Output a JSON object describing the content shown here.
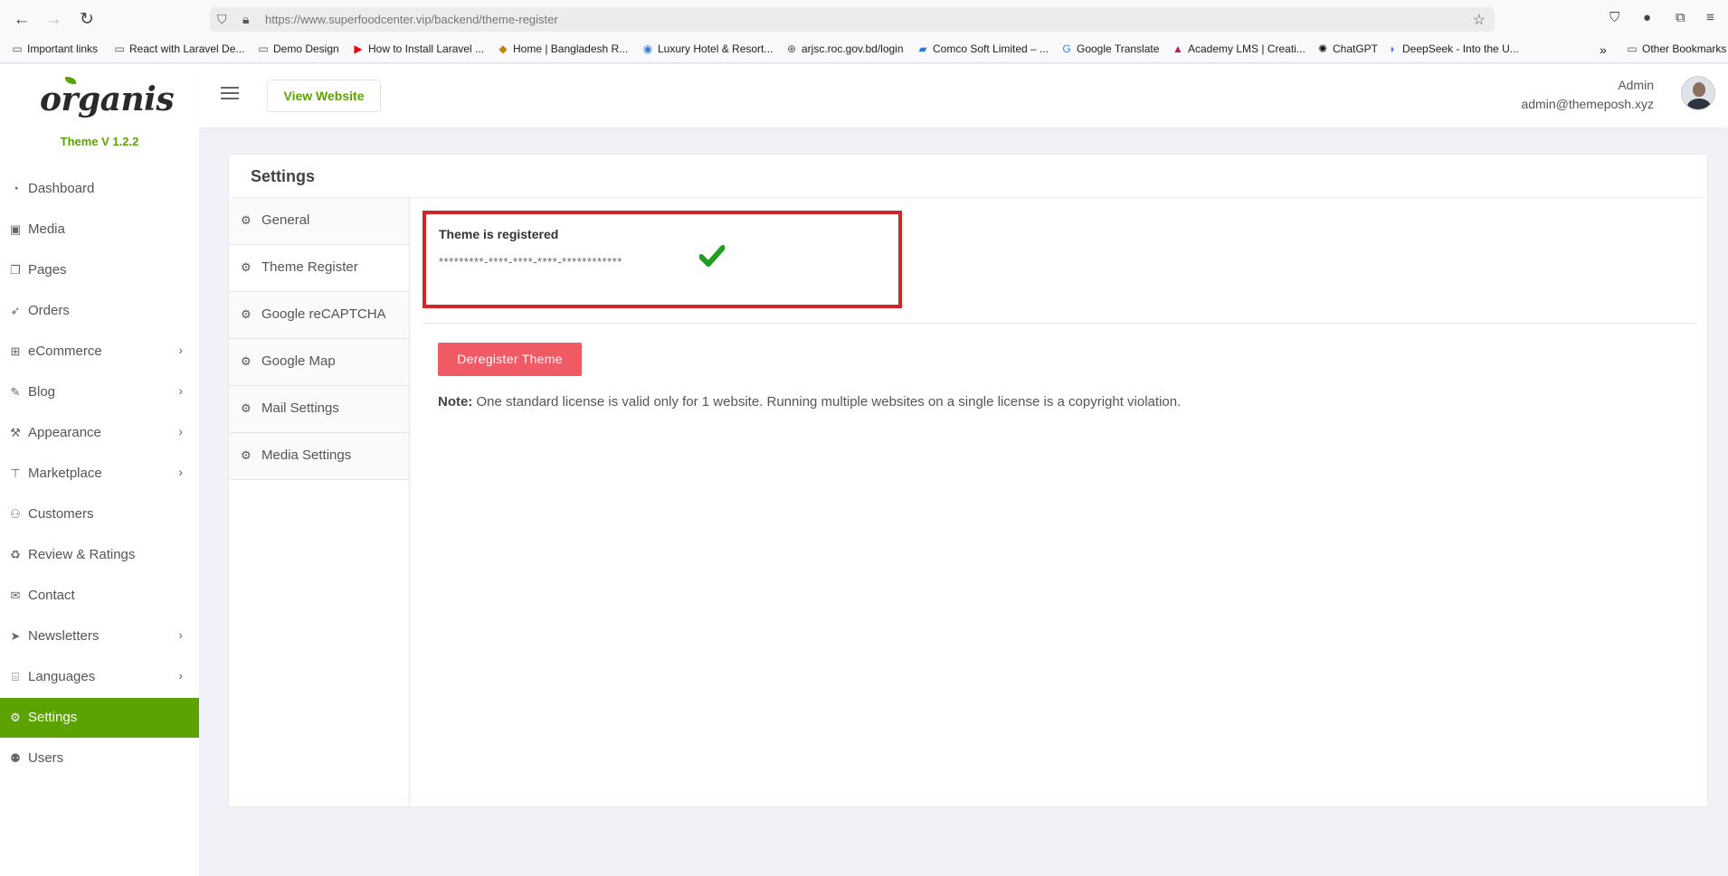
{
  "browser": {
    "url": "https://www.superfoodcenter.vip/backend/theme-register",
    "bookmarks": [
      "Important links",
      "React with Laravel De...",
      "Demo Design",
      "How to Install Laravel ...",
      "Home | Bangladesh R...",
      "Luxury Hotel & Resort...",
      "arjsc.roc.gov.bd/login",
      "Comco Soft Limited – ...",
      "Google Translate",
      "Academy LMS | Creati...",
      "ChatGPT",
      "DeepSeek - Into the U...",
      "Other Bookmarks"
    ]
  },
  "brand": {
    "logo_text": "organis",
    "version": "Theme V 1.2.2",
    "accent_color": "#5aa300"
  },
  "sidebar": {
    "items": [
      {
        "label": "Dashboard",
        "icon": "dashboard-icon"
      },
      {
        "label": "Media",
        "icon": "image-icon"
      },
      {
        "label": "Pages",
        "icon": "pages-icon"
      },
      {
        "label": "Orders",
        "icon": "rocket-icon"
      },
      {
        "label": "eCommerce",
        "icon": "cart-icon"
      },
      {
        "label": "Blog",
        "icon": "blog-icon"
      },
      {
        "label": "Appearance",
        "icon": "wrench-icon"
      },
      {
        "label": "Marketplace",
        "icon": "sitemap-icon"
      },
      {
        "label": "Customers",
        "icon": "users-icon"
      },
      {
        "label": "Review & Ratings",
        "icon": "recycle-icon"
      },
      {
        "label": "Contact",
        "icon": "envelope-icon"
      },
      {
        "label": "Newsletters",
        "icon": "paper-plane-icon"
      },
      {
        "label": "Languages",
        "icon": "language-icon"
      },
      {
        "label": "Settings",
        "icon": "cogs-icon"
      },
      {
        "label": "Users",
        "icon": "user-plus-icon"
      }
    ]
  },
  "header": {
    "view_website": "View Website",
    "user_name": "Admin",
    "user_email": "admin@themeposh.xyz"
  },
  "settings": {
    "title": "Settings",
    "tabs": [
      "General",
      "Theme Register",
      "Google reCAPTCHA",
      "Google Map",
      "Mail Settings",
      "Media Settings"
    ],
    "active_tab": "Theme Register",
    "register_status": "Theme is registered",
    "license_key_masked": "*********-****-****-****-************",
    "deregister_button": "Deregister Theme",
    "note_label": "Note:",
    "note_text": "One standard license is valid only for 1 website. Running multiple websites on a single license is a copyright violation.",
    "highlight_color": "#d3262b",
    "danger_color": "#ef5a64",
    "check_color": "#1e9e1e"
  }
}
